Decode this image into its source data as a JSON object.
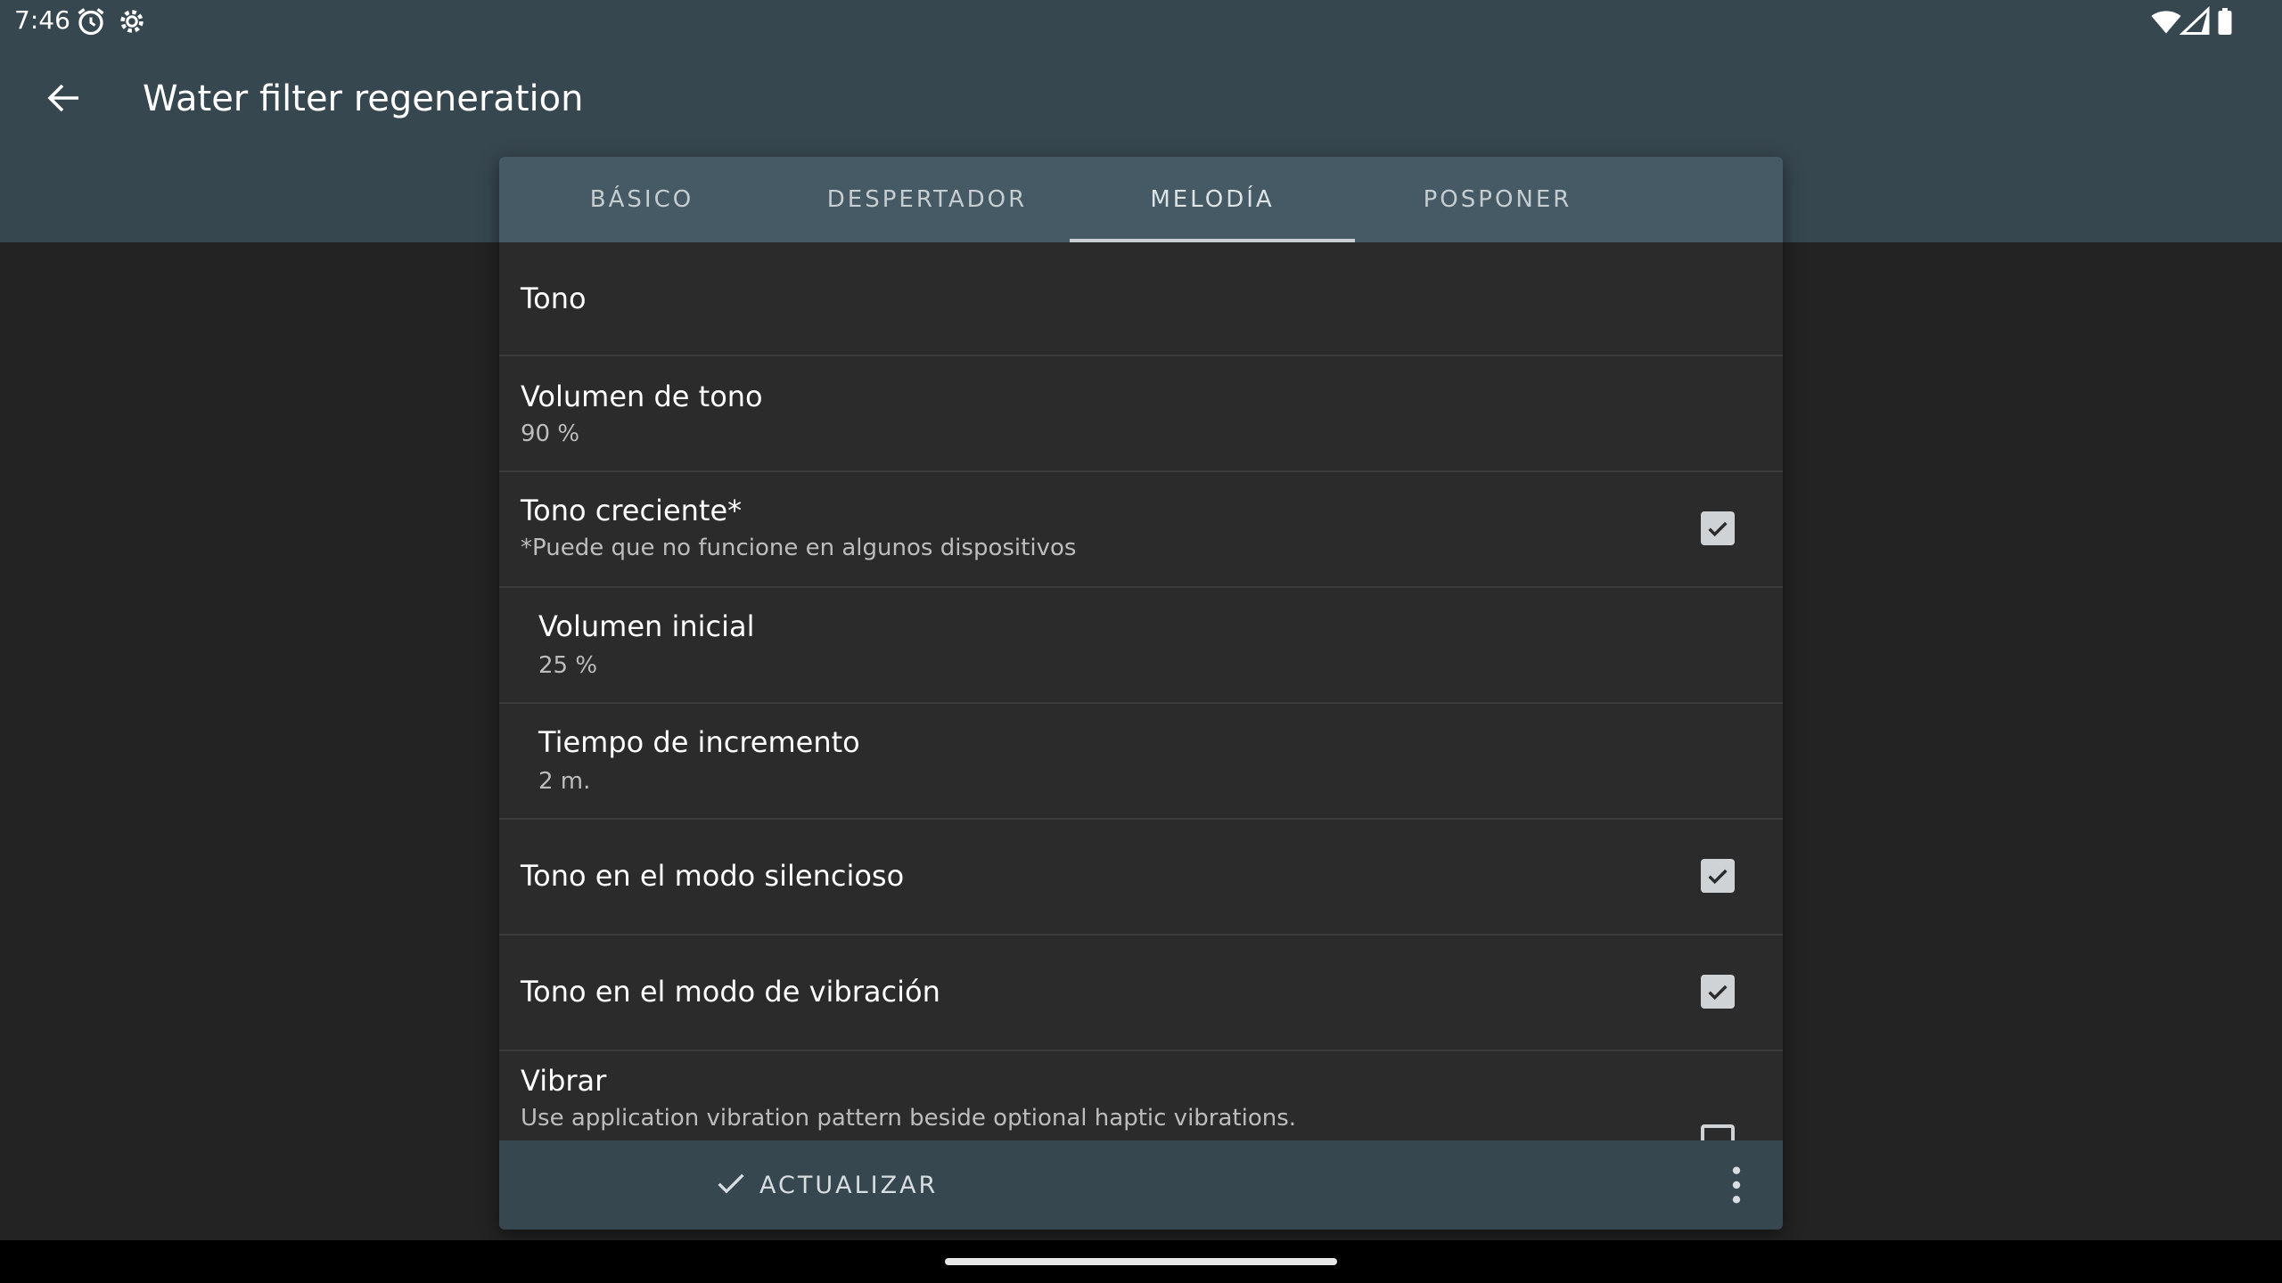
{
  "status_bar": {
    "time": "7:46",
    "left_icons": [
      "alarm-icon",
      "settings-icon"
    ],
    "right_icons": [
      "wifi-icon",
      "signal-icon",
      "battery-icon"
    ]
  },
  "app_bar": {
    "back_icon": "arrow-back-icon",
    "title": "Water filter regeneration"
  },
  "tabs": [
    {
      "label": "BÁSICO",
      "active": false
    },
    {
      "label": "DESPERTADOR",
      "active": false
    },
    {
      "label": "MELODÍA",
      "active": true
    },
    {
      "label": "POSPONER",
      "active": false
    }
  ],
  "settings": [
    {
      "title": "Tono"
    },
    {
      "title": "Volumen de tono",
      "summary": "90 %"
    },
    {
      "title": "Tono creciente*",
      "summary": "*Puede que no funcione en algunos dispositivos",
      "checked": true
    },
    {
      "title": "Volumen inicial",
      "summary": "25 %"
    },
    {
      "title": "Tiempo de incremento",
      "summary": "2 m."
    },
    {
      "title": "Tono en el modo silencioso",
      "checked": true
    },
    {
      "title": "Tono en el modo de vibración",
      "checked": true
    },
    {
      "title": "Vibrar",
      "summary": "Use application vibration pattern beside optional haptic vibrations.",
      "checked": false
    }
  ],
  "action_bar": {
    "update_label": "ACTUALIZAR",
    "update_icon": "check-icon",
    "more_icon": "more-vert-icon"
  },
  "colors": {
    "app_bar": "#37474f",
    "tab_bar": "#455a64",
    "dialog_bg": "#2b2b2b",
    "screen_bg": "#232323"
  }
}
